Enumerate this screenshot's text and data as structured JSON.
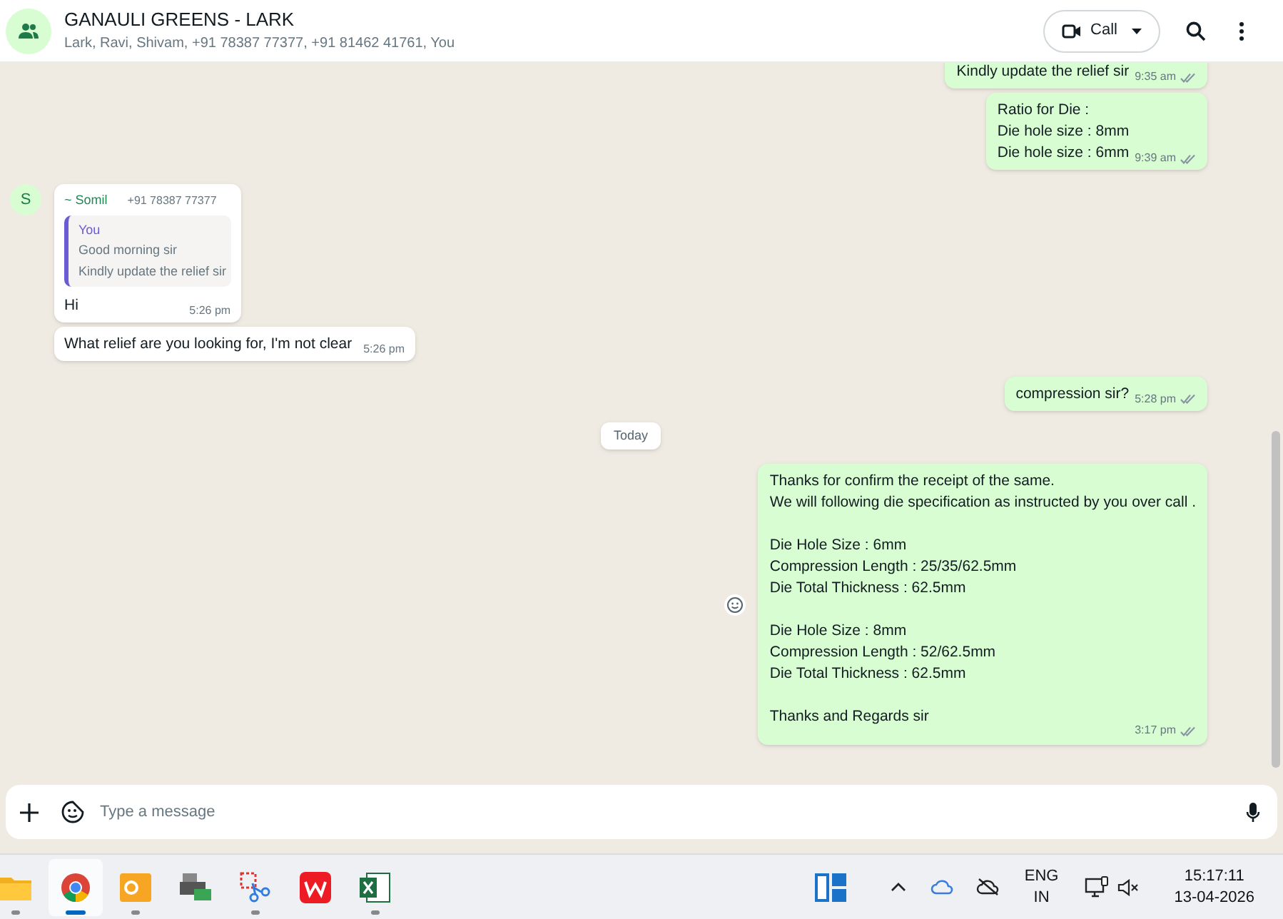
{
  "header": {
    "title": "GANAULI GREENS - LARK",
    "members": "Lark, Ravi, Shivam, +91 78387 77377, +91 81462 41761, You",
    "call_label": "Call"
  },
  "messages": [
    {
      "kind": "out",
      "lines": [
        "Kindly update the relief sir"
      ],
      "time": "9:35 am",
      "read": true
    },
    {
      "kind": "out",
      "lines": [
        "Ratio for Die :",
        "Die hole size : 8mm",
        "Die hole size : 6mm"
      ],
      "time": "9:39 am",
      "read": true
    },
    {
      "kind": "in",
      "avatar": "S",
      "sender": "~ Somil",
      "phone": "+91 78387 77377",
      "quote": {
        "author": "You",
        "lines": [
          "Good morning sir",
          "Kindly update the relief sir"
        ]
      },
      "lines": [
        "Hi"
      ],
      "time": "5:26 pm"
    },
    {
      "kind": "in",
      "lines": [
        "What relief are you looking for, I'm not clear"
      ],
      "time": "5:26 pm"
    },
    {
      "kind": "out",
      "lines": [
        "compression sir?"
      ],
      "time": "5:28 pm",
      "read": true
    },
    {
      "kind": "date",
      "label": "Today"
    },
    {
      "kind": "out",
      "paragraphs": [
        [
          "Thanks for confirm the receipt of the same.",
          "We will following die specification as instructed by you over call ."
        ],
        [
          "Die Hole Size : 6mm",
          "Compression Length : 25/35/62.5mm",
          "Die Total Thickness : 62.5mm"
        ],
        [
          "Die Hole Size : 8mm",
          "Compression Length : 52/62.5mm",
          "Die Total Thickness : 62.5mm"
        ],
        [
          "Thanks and Regards sir"
        ]
      ],
      "time": "3:17 pm",
      "read": true,
      "react_button": true
    }
  ],
  "composer": {
    "placeholder": "Type a message"
  },
  "taskbar": {
    "apps": [
      {
        "kind": "files",
        "selected": false,
        "running": true
      },
      {
        "kind": "browser",
        "selected": true,
        "running": true
      },
      {
        "kind": "mail",
        "selected": false,
        "running": true
      },
      {
        "kind": "scanner",
        "selected": false,
        "running": false
      },
      {
        "kind": "snip",
        "selected": false,
        "running": true
      },
      {
        "kind": "office",
        "selected": false,
        "running": false
      },
      {
        "kind": "sheet",
        "selected": false,
        "running": true
      }
    ],
    "lang": "ENG",
    "region": "IN",
    "time": "15:17:11",
    "date": "13-04-2026"
  }
}
